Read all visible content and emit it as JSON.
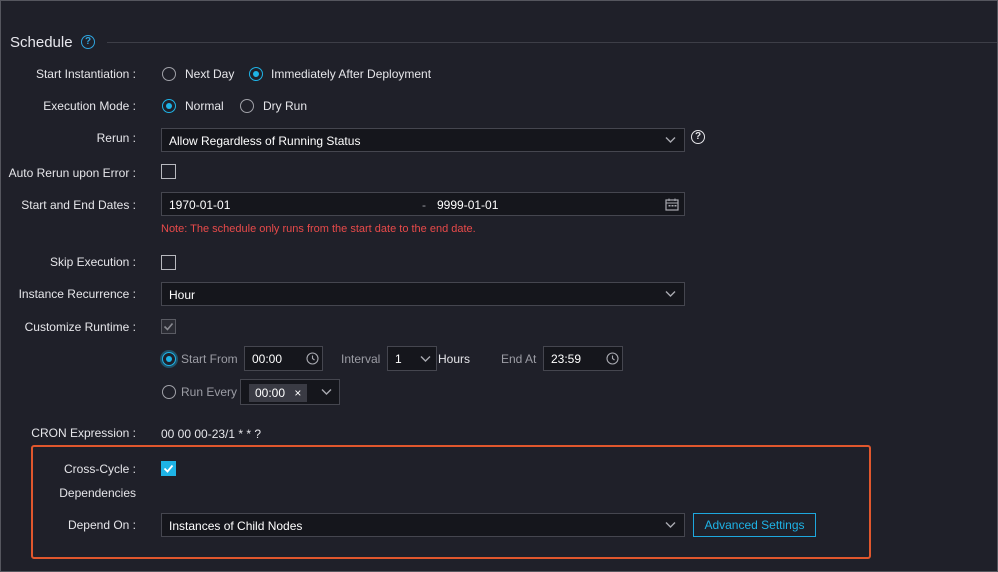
{
  "section": {
    "title": "Schedule"
  },
  "start_instantiation": {
    "label": "Start Instantiation :",
    "options": [
      "Next Day",
      "Immediately After Deployment"
    ],
    "selected": "Immediately After Deployment"
  },
  "execution_mode": {
    "label": "Execution Mode :",
    "options": [
      "Normal",
      "Dry Run"
    ],
    "selected": "Normal"
  },
  "rerun": {
    "label": "Rerun :",
    "value": "Allow Regardless of Running Status"
  },
  "auto_rerun": {
    "label": "Auto Rerun upon Error :",
    "checked": false
  },
  "dates": {
    "label": "Start and End Dates :",
    "start": "1970-01-01",
    "separator": "-",
    "end": "9999-01-01",
    "note": "Note: The schedule only runs from the start date to the end date."
  },
  "skip_execution": {
    "label": "Skip Execution :",
    "checked": false
  },
  "instance_recurrence": {
    "label": "Instance Recurrence :",
    "value": "Hour"
  },
  "customize_runtime": {
    "label": "Customize Runtime :",
    "checked": true
  },
  "start_from": {
    "label": "Start From",
    "time": "00:00",
    "interval_label": "Interval",
    "interval_value": "1",
    "interval_unit": "Hours",
    "end_label": "End At",
    "end_time": "23:59"
  },
  "run_every": {
    "label": "Run Every",
    "tag": "00:00",
    "tag_remove": "×"
  },
  "cron": {
    "label": "CRON Expression :",
    "value": "00 00 00-23/1 * * ?"
  },
  "cross_cycle": {
    "label_line1": "Cross-Cycle :",
    "label_line2": "Dependencies",
    "checked": true
  },
  "depend_on": {
    "label": "Depend On :",
    "value": "Instances of Child Nodes",
    "advanced_button": "Advanced Settings"
  },
  "help_glyph": "?",
  "colors": {
    "accent": "#1eb3e6",
    "error": "#e84a4a",
    "highlight": "#e0572d",
    "background": "#1f2029"
  }
}
